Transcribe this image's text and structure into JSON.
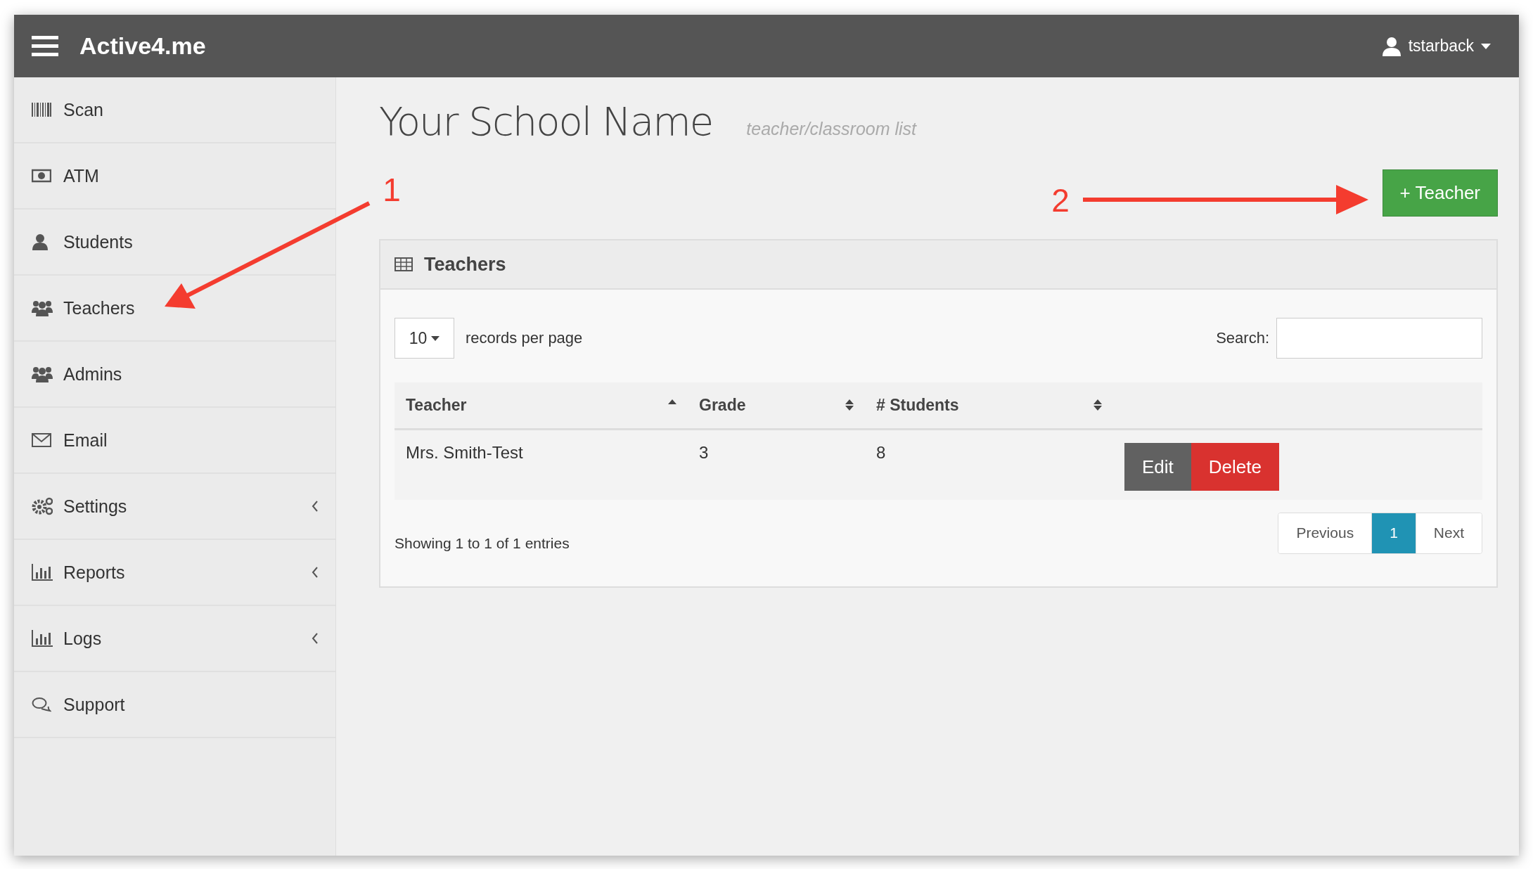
{
  "header": {
    "app_title": "Active4.me",
    "user": "tstarback"
  },
  "sidebar": {
    "items": [
      {
        "label": "Scan",
        "expandable": false
      },
      {
        "label": "ATM",
        "expandable": false
      },
      {
        "label": "Students",
        "expandable": false
      },
      {
        "label": "Teachers",
        "expandable": false
      },
      {
        "label": "Admins",
        "expandable": false
      },
      {
        "label": "Email",
        "expandable": false
      },
      {
        "label": "Settings",
        "expandable": true
      },
      {
        "label": "Reports",
        "expandable": true
      },
      {
        "label": "Logs",
        "expandable": true
      },
      {
        "label": "Support",
        "expandable": false
      }
    ]
  },
  "page": {
    "title": "Your School Name",
    "subtitle": "teacher/classroom list",
    "add_button": "+ Teacher"
  },
  "panel": {
    "title": "Teachers",
    "page_size": "10",
    "page_size_label": "records per page",
    "search_label": "Search:",
    "table": {
      "columns": [
        {
          "label": "Teacher",
          "sorted": true
        },
        {
          "label": "Grade",
          "sorted": false
        },
        {
          "label": "# Students",
          "sorted": false
        }
      ],
      "rows": [
        {
          "teacher": "Mrs. Smith-Test",
          "grade": "3",
          "students": "8",
          "actions": [
            "Edit",
            "Delete"
          ]
        }
      ]
    },
    "info": "Showing 1 to 1 of 1 entries",
    "pagination": [
      {
        "label": "Previous",
        "selected": false
      },
      {
        "label": "1",
        "selected": true
      },
      {
        "label": "Next",
        "selected": false
      }
    ]
  },
  "annotations": [
    {
      "label": "1"
    },
    {
      "label": "2"
    }
  ]
}
